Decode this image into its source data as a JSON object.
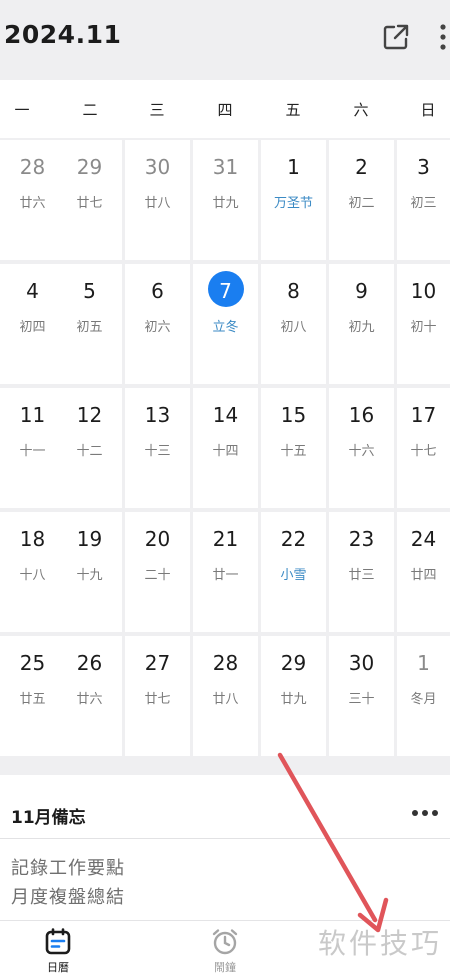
{
  "header": {
    "title": "2024.11",
    "share_icon": "external-link-icon",
    "more_icon": "vertical-dots-icon"
  },
  "weekdays": [
    "一",
    "二",
    "三",
    "四",
    "五",
    "六",
    "日"
  ],
  "calendar": {
    "weeks": [
      [
        {
          "day": "28",
          "sub": "廿六",
          "other": true
        },
        {
          "day": "29",
          "sub": "廿七",
          "other": true
        },
        {
          "day": "30",
          "sub": "廿八",
          "other": true
        },
        {
          "day": "31",
          "sub": "廿九",
          "other": true
        },
        {
          "day": "1",
          "sub": "万圣节",
          "festival": true
        },
        {
          "day": "2",
          "sub": "初二"
        },
        {
          "day": "3",
          "sub": "初三"
        }
      ],
      [
        {
          "day": "4",
          "sub": "初四"
        },
        {
          "day": "5",
          "sub": "初五"
        },
        {
          "day": "6",
          "sub": "初六"
        },
        {
          "day": "7",
          "sub": "立冬",
          "today": true,
          "festival": true
        },
        {
          "day": "8",
          "sub": "初八"
        },
        {
          "day": "9",
          "sub": "初九"
        },
        {
          "day": "10",
          "sub": "初十"
        }
      ],
      [
        {
          "day": "11",
          "sub": "十一"
        },
        {
          "day": "12",
          "sub": "十二"
        },
        {
          "day": "13",
          "sub": "十三"
        },
        {
          "day": "14",
          "sub": "十四"
        },
        {
          "day": "15",
          "sub": "十五"
        },
        {
          "day": "16",
          "sub": "十六"
        },
        {
          "day": "17",
          "sub": "十七"
        }
      ],
      [
        {
          "day": "18",
          "sub": "十八"
        },
        {
          "day": "19",
          "sub": "十九"
        },
        {
          "day": "20",
          "sub": "二十"
        },
        {
          "day": "21",
          "sub": "廿一"
        },
        {
          "day": "22",
          "sub": "小雪",
          "festival": true
        },
        {
          "day": "23",
          "sub": "廿三"
        },
        {
          "day": "24",
          "sub": "廿四"
        }
      ],
      [
        {
          "day": "25",
          "sub": "廿五"
        },
        {
          "day": "26",
          "sub": "廿六"
        },
        {
          "day": "27",
          "sub": "廿七"
        },
        {
          "day": "28",
          "sub": "廿八"
        },
        {
          "day": "29",
          "sub": "廿九"
        },
        {
          "day": "30",
          "sub": "三十"
        },
        {
          "day": "1",
          "sub": "冬月",
          "other": true
        }
      ]
    ]
  },
  "memo": {
    "title": "11月備忘",
    "more_icon": "horizontal-dots-icon",
    "lines": [
      "記錄工作要點",
      "月度複盤總結"
    ]
  },
  "tabbar": {
    "items": [
      {
        "label": "日曆",
        "icon": "calendar-icon",
        "active": true
      },
      {
        "label": "鬧鐘",
        "icon": "alarm-clock-icon",
        "active": false
      }
    ]
  },
  "watermark": "软件技巧",
  "colors": {
    "accent": "#1a7ef0",
    "festival": "#3b8ac4",
    "annotation_arrow": "#e0555a"
  }
}
